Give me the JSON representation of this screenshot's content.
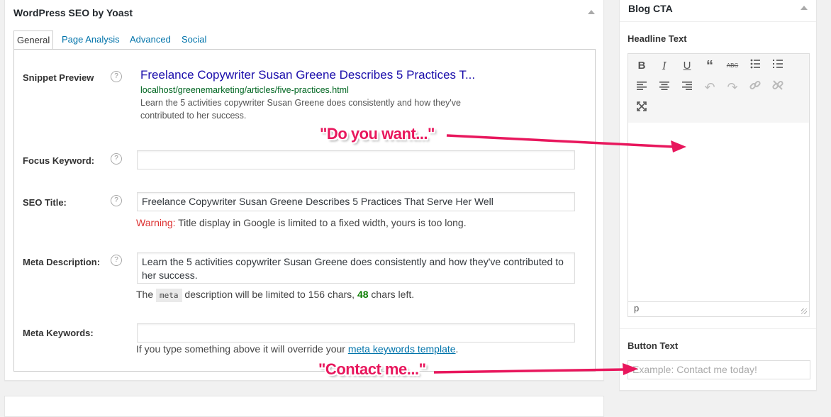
{
  "yoast": {
    "title": "WordPress SEO by Yoast",
    "tabs": [
      "General",
      "Page Analysis",
      "Advanced",
      "Social"
    ],
    "snippet": {
      "label": "Snippet Preview",
      "title": "Freelance Copywriter Susan Greene Describes 5 Practices T...",
      "url": "localhost/greenemarketing/articles/five-practices.html",
      "desc_line1": "Learn the 5 activities copywriter Susan Greene does consistently and how they've",
      "desc_line2": "contributed to her success."
    },
    "focus": {
      "label": "Focus Keyword:",
      "value": ""
    },
    "seo_title": {
      "label": "SEO Title:",
      "value": "Freelance Copywriter Susan Greene Describes 5 Practices That Serve Her Well",
      "warning_label": "Warning:",
      "warning_text": " Title display in Google is limited to a fixed width, yours is too long."
    },
    "meta_desc": {
      "label": "Meta Description:",
      "value": "Learn the 5 activities copywriter Susan Greene does consistently and how they've contributed to her success.",
      "note_pre": "The ",
      "note_code": "meta",
      "note_mid": " description will be limited to 156 chars, ",
      "note_count": "48",
      "note_post": " chars left."
    },
    "meta_keywords": {
      "label": "Meta Keywords:",
      "value": "",
      "note_pre": "If you type something above it will override your ",
      "note_link": "meta keywords template",
      "note_post": "."
    },
    "help_glyph": "?"
  },
  "cta": {
    "title": "Blog CTA",
    "headline_label": "Headline Text",
    "status_path": "p",
    "button_label": "Button Text",
    "button_placeholder": "Example: Contact me today!",
    "toolbar": [
      "bold-icon",
      "italic-icon",
      "underline-icon",
      "blockquote-icon",
      "strikethrough-icon",
      "bullet-list-icon",
      "numbered-list-icon",
      "align-left-icon",
      "align-center-icon",
      "align-right-icon",
      "undo-icon",
      "redo-icon",
      "link-icon",
      "unlink-icon",
      "fullscreen-icon"
    ]
  },
  "annotations": {
    "first": "\"Do you want...\"",
    "second": "\"Contact me...\"",
    "color": "#e8175d"
  }
}
